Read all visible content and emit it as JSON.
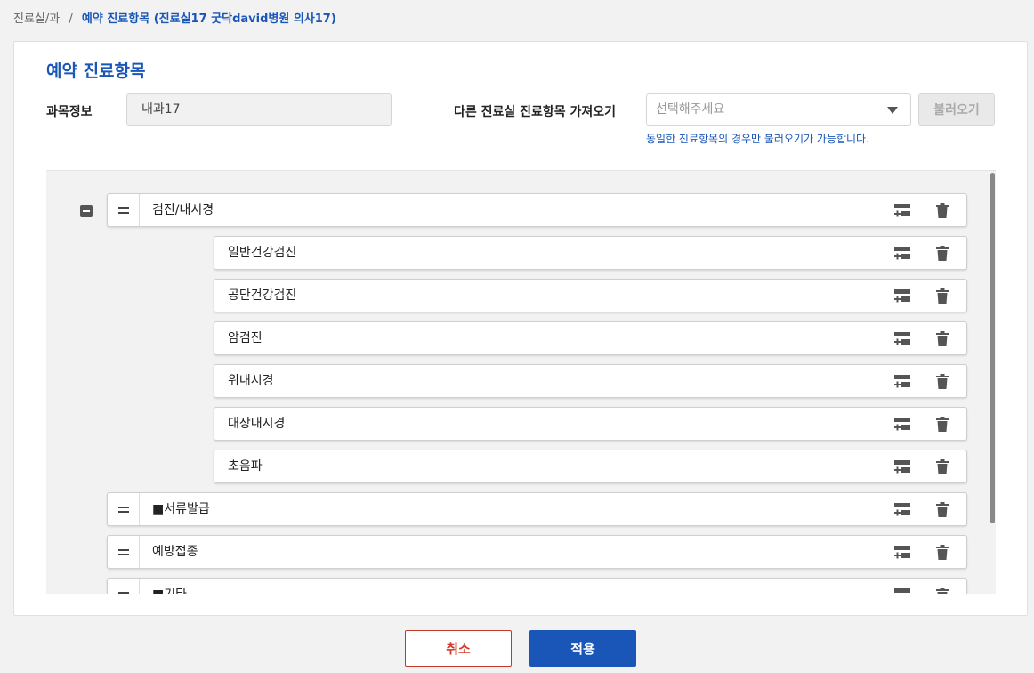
{
  "breadcrumb": {
    "parent": "진료실/과",
    "separator": "/",
    "current": "예약 진료항목 (진료실17 굿닥david병원 의사17)"
  },
  "panel": {
    "title": "예약 진료항목",
    "dept_label": "과목정보",
    "dept_value": "내과17",
    "import_label": "다른 진료실 진료항목 가져오기",
    "select_placeholder": "선택해주세요",
    "load_button": "불러오기",
    "hint": "동일한 진료항목의 경우만 불러오기가 가능합니다."
  },
  "tree": [
    {
      "label": "검진/내시경",
      "level": 0,
      "expanded": true
    },
    {
      "label": "일반건강검진",
      "level": 1
    },
    {
      "label": "공단건강검진",
      "level": 1
    },
    {
      "label": "암검진",
      "level": 1
    },
    {
      "label": "위내시경",
      "level": 1
    },
    {
      "label": "대장내시경",
      "level": 1
    },
    {
      "label": "초음파",
      "level": 1
    },
    {
      "label": "■서류발급",
      "level": 0
    },
    {
      "label": "예방접종",
      "level": 0
    },
    {
      "label": "■기타",
      "level": 0
    }
  ],
  "footer": {
    "cancel": "취소",
    "apply": "적용"
  },
  "colors": {
    "accent": "#1a56b8",
    "danger": "#d23a2a"
  },
  "icons": {
    "collapse": "minus-square-icon",
    "drag": "drag-handle-icon",
    "add": "add-subitem-icon",
    "delete": "trash-icon"
  }
}
